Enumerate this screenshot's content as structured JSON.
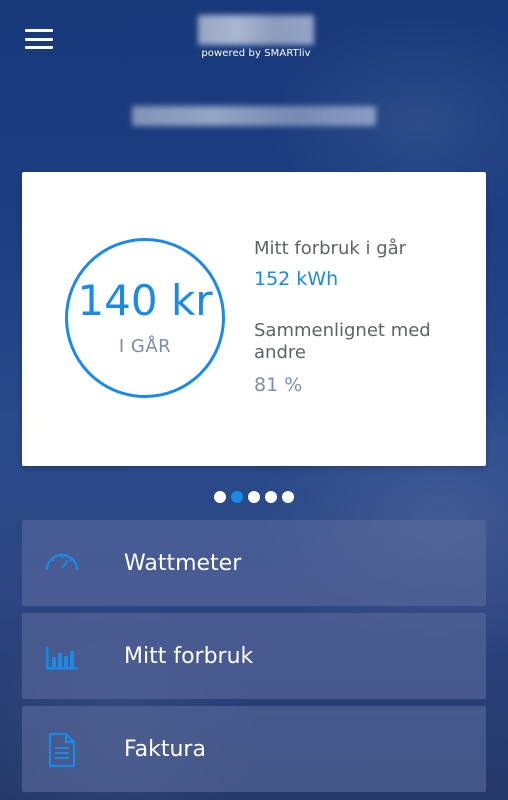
{
  "header": {
    "menu_icon": "hamburger-menu-icon",
    "powered_by": "powered by SMARTliv"
  },
  "summary_card": {
    "amount": "140 kr",
    "period_label": "I GÅR",
    "consumption_label": "Mitt forbruk i går",
    "consumption_value": "152 kWh",
    "comparison_label": "Sammenlignet med andre",
    "comparison_value": "81 %",
    "colors": {
      "accent": "#1a8ae5",
      "muted": "#7d8fab"
    }
  },
  "carousel": {
    "total_pages": 5,
    "active_index": 1
  },
  "nav": [
    {
      "label": "Wattmeter",
      "icon": "gauge-icon"
    },
    {
      "label": "Mitt forbruk",
      "icon": "bar-chart-icon"
    },
    {
      "label": "Faktura",
      "icon": "document-icon"
    }
  ]
}
